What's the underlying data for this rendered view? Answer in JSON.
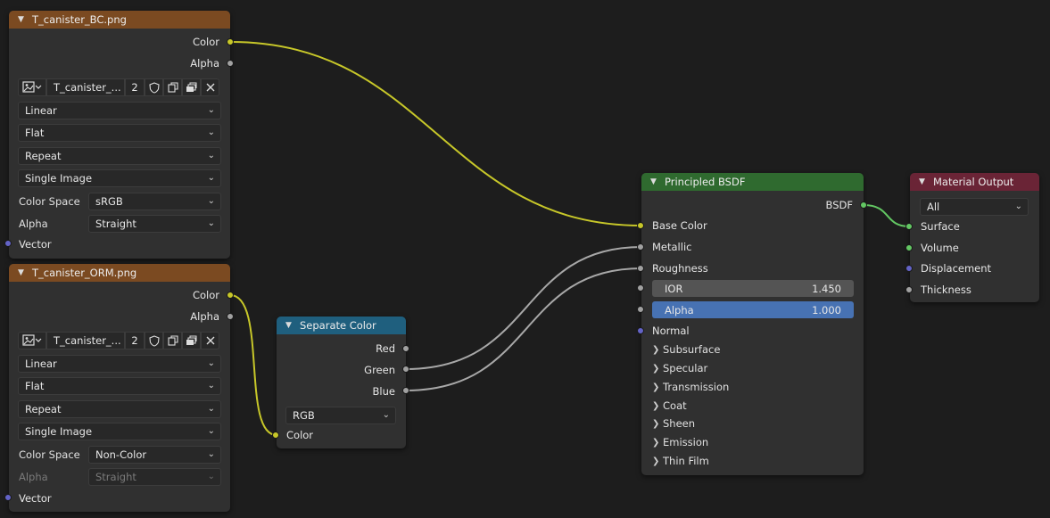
{
  "nodes": {
    "image_bc": {
      "title": "T_canister_BC.png",
      "outputs": [
        "Color",
        "Alpha"
      ],
      "image_name": "T_canister_...",
      "users": "2",
      "interpolation": "Linear",
      "projection": "Flat",
      "extension": "Repeat",
      "source": "Single Image",
      "color_space_label": "Color Space",
      "color_space": "sRGB",
      "alpha_label": "Alpha",
      "alpha_mode": "Straight",
      "input": "Vector"
    },
    "image_orm": {
      "title": "T_canister_ORM.png",
      "outputs": [
        "Color",
        "Alpha"
      ],
      "image_name": "T_canister_...",
      "users": "2",
      "interpolation": "Linear",
      "projection": "Flat",
      "extension": "Repeat",
      "source": "Single Image",
      "color_space_label": "Color Space",
      "color_space": "Non-Color",
      "alpha_label": "Alpha",
      "alpha_mode": "Straight",
      "input": "Vector"
    },
    "separate": {
      "title": "Separate Color",
      "outputs": [
        "Red",
        "Green",
        "Blue"
      ],
      "mode": "RGB",
      "input": "Color"
    },
    "bsdf": {
      "title": "Principled BSDF",
      "output": "BSDF",
      "inputs": [
        "Base Color",
        "Metallic",
        "Roughness"
      ],
      "ior_label": "IOR",
      "ior_value": "1.450",
      "alpha_label": "Alpha",
      "alpha_value": "1.000",
      "normal": "Normal",
      "panels": [
        "Subsurface",
        "Specular",
        "Transmission",
        "Coat",
        "Sheen",
        "Emission",
        "Thin Film"
      ]
    },
    "output": {
      "title": "Material Output",
      "target": "All",
      "inputs": [
        "Surface",
        "Volume",
        "Displacement",
        "Thickness"
      ]
    }
  },
  "colors": {
    "image_header": "#7b4a21",
    "convert_header": "#1f5f7e",
    "shader_header": "#2f6a2f",
    "output_header": "#6a2436",
    "color_socket": "#c7c729",
    "float_socket": "#a1a1a1",
    "vector_socket": "#6363c7",
    "shader_socket": "#63c763"
  }
}
